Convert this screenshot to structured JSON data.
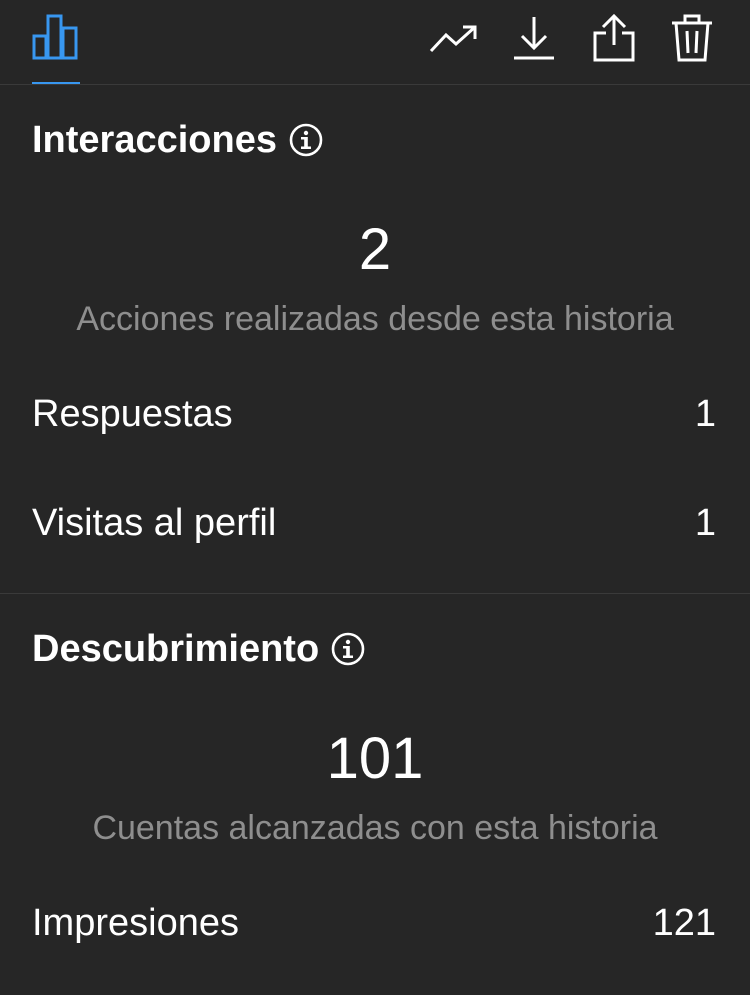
{
  "toolbar": {
    "tabs": [
      {
        "icon": "bar-chart-icon",
        "active": true,
        "accent": "#3897f0"
      }
    ],
    "actions": [
      {
        "icon": "trending-up-icon"
      },
      {
        "icon": "download-icon"
      },
      {
        "icon": "share-icon"
      },
      {
        "icon": "trash-icon"
      }
    ]
  },
  "interactions": {
    "title": "Interacciones",
    "total": "2",
    "subtitle": "Acciones realizadas desde esta historia",
    "rows": [
      {
        "label": "Respuestas",
        "value": "1"
      },
      {
        "label": "Visitas al perfil",
        "value": "1"
      }
    ]
  },
  "discovery": {
    "title": "Descubrimiento",
    "total": "101",
    "subtitle": "Cuentas alcanzadas con esta historia",
    "rows": [
      {
        "label": "Impresiones",
        "value": "121"
      }
    ]
  }
}
